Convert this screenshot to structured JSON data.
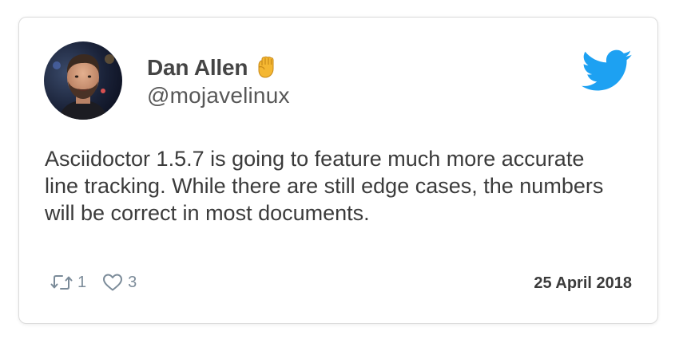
{
  "author": {
    "name": "Dan Allen",
    "emoji": "raised-fist",
    "handle": "@mojavelinux"
  },
  "tweet": {
    "text": "Asciidoctor 1.5.7 is going to feature much more accurate line tracking. While there are still edge cases, the numbers will be correct in most documents."
  },
  "stats": {
    "retweets": "1",
    "likes": "3"
  },
  "date": "25 April 2018",
  "icons": {
    "brand": "twitter-bird-icon",
    "retweet": "retweet-icon",
    "like": "heart-icon"
  },
  "colors": {
    "twitter_blue": "#1da1f2",
    "action_gray": "#7b8b99"
  }
}
